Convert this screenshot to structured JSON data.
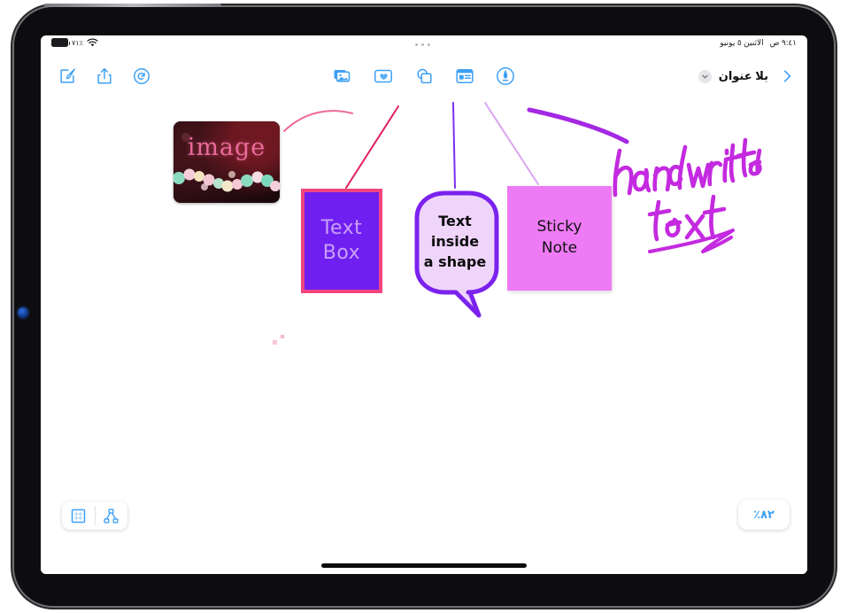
{
  "status_bar": {
    "battery_label": "٧١٪",
    "battery_icon": "battery-icon",
    "wifi_icon": "wifi-icon",
    "multitask_dots": "•••",
    "time": "٩:٤١ ص",
    "date": "الاثنين ٥ يونيو"
  },
  "toolbar": {
    "compose": {
      "label": "إنشاء",
      "icon": "compose-icon"
    },
    "share": {
      "label": "مشاركة",
      "icon": "share-icon"
    },
    "redo": {
      "label": "إعادة",
      "icon": "redo-icon"
    },
    "insert_tools": [
      {
        "name": "media-icon",
        "label": "الوسائط"
      },
      {
        "name": "sticker-icon",
        "label": "ملصق"
      },
      {
        "name": "shapes-icon",
        "label": "الأشكال"
      },
      {
        "name": "sticky-note-icon",
        "label": "ملاحظة لاصقة"
      },
      {
        "name": "pen-icon",
        "label": "قلم"
      }
    ],
    "document_title": "بلا عنوان",
    "document_menu_icon": "chevron-down-icon",
    "next_chevron_icon": "chevron-right-icon"
  },
  "canvas": {
    "image_card": {
      "caption": "image",
      "name": "image-object"
    },
    "text_box": {
      "line1": "Text",
      "line2": "Box",
      "fill_color": "#6f1ff0",
      "border_color": "#f2457f"
    },
    "shape": {
      "line1": "Text",
      "line2": "inside",
      "line3": "a shape",
      "fill_color": "#f0d5fb",
      "stroke_color": "#7b22ee"
    },
    "sticky_note": {
      "line1": "Sticky",
      "line2": "Note",
      "fill_color": "#ee7bf5"
    },
    "handwriting": {
      "text": "handwritten text",
      "ink_color": "#c42ae0"
    },
    "connectors": [
      {
        "name": "connector-to-image",
        "color": "#ef6a95"
      },
      {
        "name": "connector-to-text-box",
        "color": "#e01f5c"
      },
      {
        "name": "connector-to-shape",
        "color": "#7c2ff0"
      },
      {
        "name": "connector-to-sticky-note",
        "color": "#dba3f2"
      },
      {
        "name": "connector-to-handwriting",
        "color": "#a428e3"
      }
    ]
  },
  "bottom_bar": {
    "grid_button": {
      "icon": "grid-icon",
      "label": "الشبكة"
    },
    "connectors_button": {
      "icon": "connector-diagram-icon",
      "label": "الموصّلات"
    },
    "zoom_level": "٨٢٪"
  },
  "colors": {
    "accent": "#3da0f5",
    "ink_purple": "#c42ae0",
    "sticky_pink": "#ee7bf5",
    "textbox_purple": "#6f1ff0",
    "textbox_border": "#f2457f",
    "shape_fill": "#f0d5fb",
    "shape_stroke": "#7b22ee"
  }
}
